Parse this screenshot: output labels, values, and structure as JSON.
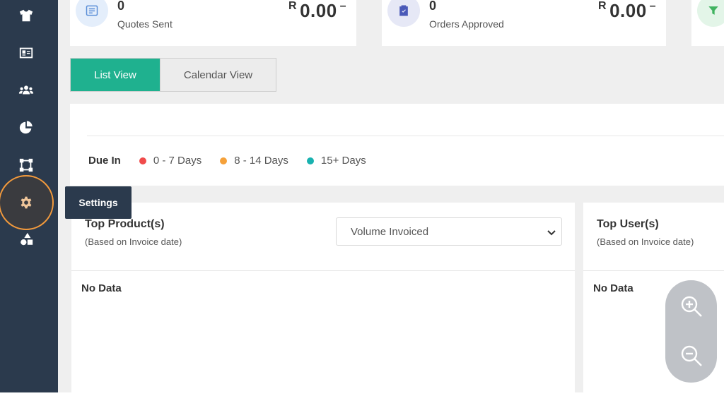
{
  "tooltip": {
    "text": "Settings"
  },
  "sidebar": {
    "icons": [
      "tshirt-icon",
      "id-card-icon",
      "users-icon",
      "pie-chart-icon",
      "vector-square-icon",
      "cog-icon",
      "shapes-icon"
    ]
  },
  "stats": [
    {
      "count": "0",
      "label": "Quotes Sent",
      "currency": "R",
      "amount": "0.00",
      "dash": "–",
      "icon": "list-icon",
      "icon_bg": "#e4eefb",
      "icon_color": "#5b8fd8"
    },
    {
      "count": "0",
      "label": "Orders Approved",
      "currency": "R",
      "amount": "0.00",
      "dash": "–",
      "icon": "clipboard-check-icon",
      "icon_bg": "#e6e8f6",
      "icon_color": "#4a59b8"
    },
    {
      "icon": "filter-icon",
      "icon_bg": "#e3f5e8",
      "icon_color": "#3fb35f"
    }
  ],
  "views": {
    "list": "List View",
    "calendar": "Calendar View"
  },
  "due": {
    "label": "Due In",
    "items": [
      {
        "text": "0 - 7 Days",
        "color": "#f04b4b"
      },
      {
        "text": "8 - 14 Days",
        "color": "#f5a13a"
      },
      {
        "text": "15+ Days",
        "color": "#19b2b0"
      }
    ]
  },
  "top_products": {
    "title": "Top Product(s)",
    "subtitle": "(Based on Invoice date)",
    "select_value": "Volume Invoiced",
    "no_data": "No Data"
  },
  "top_users": {
    "title": "Top User(s)",
    "subtitle": "(Based on Invoice date)",
    "no_data": "No Data"
  },
  "colors": {
    "accent": "#1fb18f",
    "sidebar": "#2b3a4d",
    "highlight": "#f39a3c"
  }
}
